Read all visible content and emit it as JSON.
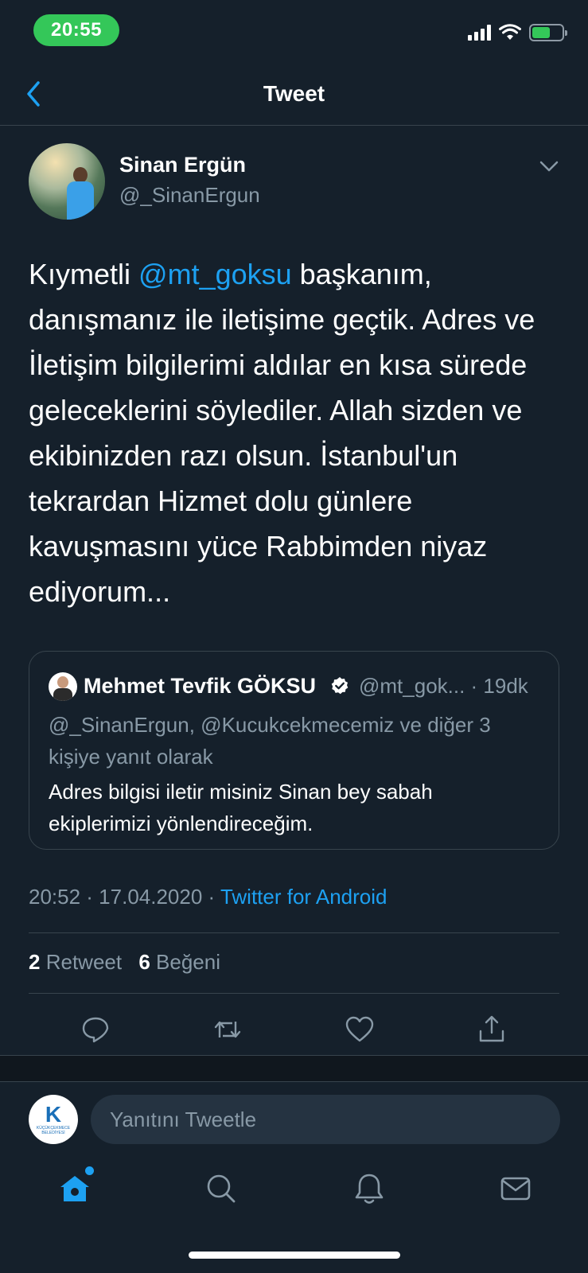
{
  "status_bar": {
    "time": "20:55"
  },
  "nav": {
    "title": "Tweet"
  },
  "tweet": {
    "author_name": "Sinan Ergün",
    "author_handle": "@_SinanErgun",
    "text_part1": "Kıymetli ",
    "mention": "@mt_goksu",
    "text_part2": " başkanım, danışmanız ile iletişime geçtik. Adres ve İletişim bilgilerimi aldılar en kısa sürede geleceklerini söylediler. Allah sizden ve ekibinizden razı olsun. İstanbul'un tekrardan Hizmet dolu günlere kavuşmasını yüce Rabbimden niyaz ediyorum...",
    "time": "20:52 · 17.04.2020 · ",
    "source": "Twitter for Android"
  },
  "quoted_tweet": {
    "name": "Mehmet Tevfik GÖKSU",
    "handle_time": "@mt_gok... · 19dk",
    "reply_context": "@_SinanErgun, @Kucukcekmecemiz ve diğer 3 kişiye yanıt olarak",
    "text": "Adres bilgisi iletir misiniz Sinan bey sabah ekiplerimizi yönlendireceğim."
  },
  "stats": {
    "retweets_count": "2",
    "retweets_label": "Retweet",
    "likes_count": "6",
    "likes_label": "Beğeni"
  },
  "reply": {
    "placeholder": "Yanıtını Tweetle",
    "avatar_logo": "K",
    "avatar_caption": "KÜÇÜKÇEKMECE BELEDİYESİ"
  },
  "icons": {
    "back": "chevron-left-icon",
    "more": "chevron-down-icon",
    "reply": "comment-icon",
    "retweet": "retweet-icon",
    "like": "heart-icon",
    "share": "share-icon",
    "home": "home-icon",
    "search": "search-icon",
    "notifications": "bell-icon",
    "messages": "mail-icon"
  },
  "colors": {
    "background": "#15202b",
    "accent": "#1da1f2",
    "secondary_text": "#8899a6",
    "border": "#38444d",
    "time_pill": "#34c759"
  }
}
